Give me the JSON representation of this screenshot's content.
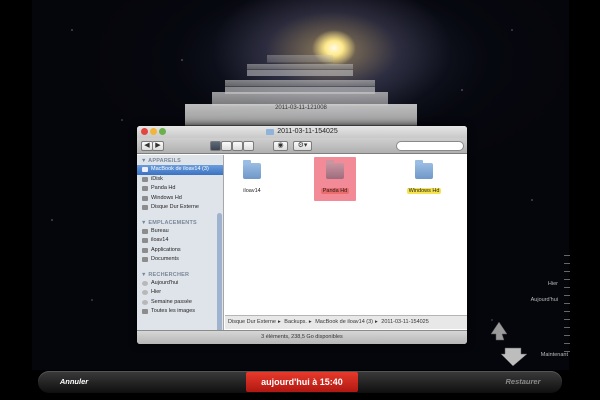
{
  "window": {
    "title": "2011-03-11-154025",
    "back_forward": [
      "◀",
      "▶"
    ],
    "view_buttons": [
      "view-icons",
      "view-list",
      "view-columns",
      "view-coverflow"
    ],
    "eye_label": "◉",
    "gear_label": "⚙▾"
  },
  "stack_titles": [
    "2011-03-11-121008"
  ],
  "sidebar": {
    "sections": [
      {
        "heading": "▼ APPAREILS",
        "items": [
          {
            "label": "MacBook de iloav14 (3)",
            "icon": "laptop-icon",
            "selected": true
          },
          {
            "label": "iDisk",
            "icon": "idisk-icon"
          },
          {
            "label": "Panda Hd",
            "icon": "disk-icon"
          },
          {
            "label": "Windows Hd",
            "icon": "disk-icon"
          },
          {
            "label": "Disque Dur Externe",
            "icon": "external-disk-icon"
          }
        ]
      },
      {
        "heading": "▼ EMPLACEMENTS",
        "items": [
          {
            "label": "Bureau",
            "icon": "desktop-icon"
          },
          {
            "label": "iloav14",
            "icon": "home-icon"
          },
          {
            "label": "Applications",
            "icon": "applications-icon"
          },
          {
            "label": "Documents",
            "icon": "documents-icon"
          }
        ]
      },
      {
        "heading": "▼ RECHERCHER",
        "items": [
          {
            "label": "Aujourd'hui",
            "icon": "clock-icon"
          },
          {
            "label": "Hier",
            "icon": "clock-icon"
          },
          {
            "label": "Semaine passée",
            "icon": "clock-icon"
          },
          {
            "label": "Toutes les images",
            "icon": "images-icon"
          }
        ]
      }
    ]
  },
  "content": {
    "items": [
      {
        "label": "iloav14",
        "icon": "folder-icon",
        "highlight": "none"
      },
      {
        "label": "Panda Hd",
        "icon": "folder-icon",
        "highlight": "red"
      },
      {
        "label": "Windows Hd",
        "icon": "folder-icon",
        "highlight": "yellow"
      }
    ]
  },
  "pathbar": [
    "Disque Dur Externe",
    "Backups.",
    "MacBook de iloav14 (3)",
    "2011-03-11-154025"
  ],
  "status": "3 éléments, 238,5 Go disponibles",
  "timeline": {
    "labels": [
      "Hier",
      "Aujourd'hui",
      "Maintenant"
    ]
  },
  "bottom": {
    "cancel_label": "Annuler",
    "date_label": "aujourd'hui à 15:40",
    "restore_label": "Restaurer"
  },
  "colors": {
    "accent_red": "#c4241a",
    "highlight_red": "#ec6b6b",
    "highlight_yellow": "#f5e34f",
    "selection_blue": "#3c72c2"
  }
}
